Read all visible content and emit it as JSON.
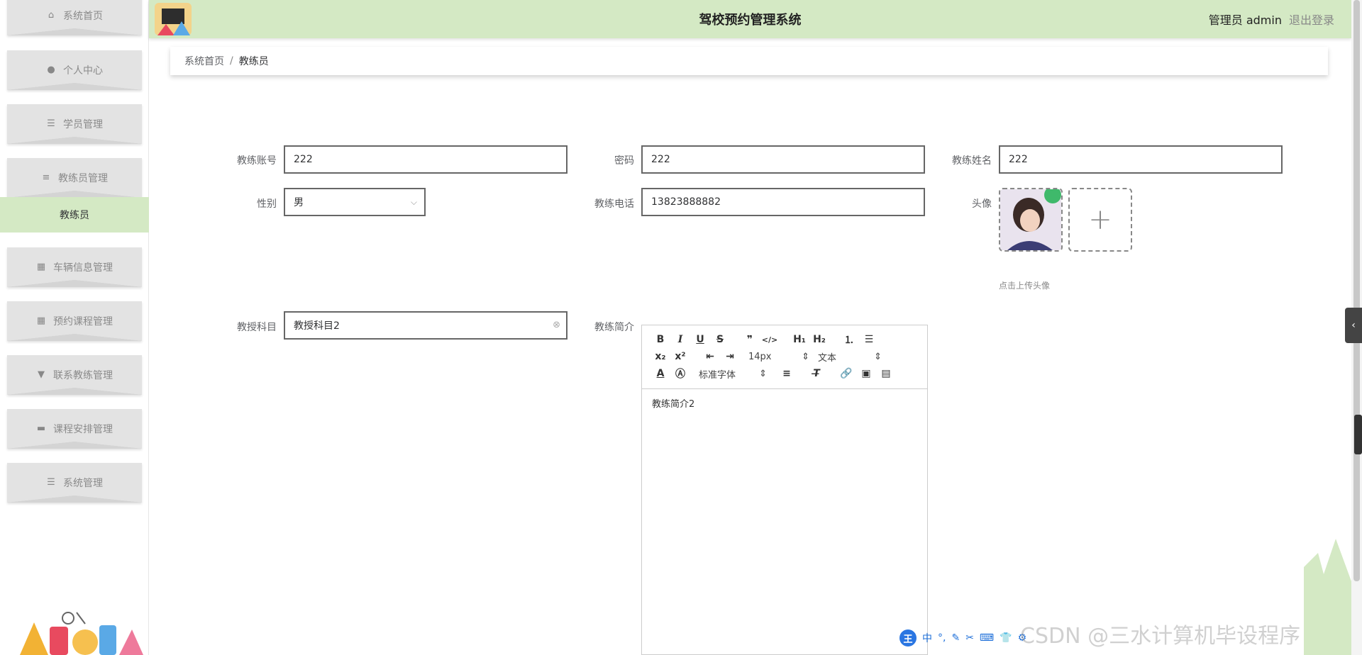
{
  "app": {
    "title": "驾校预约管理系统",
    "user_role": "管理员 admin",
    "logout": "退出登录"
  },
  "sidebar": {
    "items": [
      {
        "label": "系统首页",
        "icon": "home-icon"
      },
      {
        "label": "个人中心",
        "icon": "user-icon"
      },
      {
        "label": "学员管理",
        "icon": "list-icon"
      },
      {
        "label": "教练员管理",
        "icon": "sliders-icon"
      },
      {
        "label": "车辆信息管理",
        "icon": "grid-icon"
      },
      {
        "label": "预约课程管理",
        "icon": "grid-icon"
      },
      {
        "label": "联系教练管理",
        "icon": "brush-icon"
      },
      {
        "label": "课程安排管理",
        "icon": "monitor-icon"
      },
      {
        "label": "系统管理",
        "icon": "menu-icon"
      }
    ],
    "sub_active": "教练员"
  },
  "breadcrumb": {
    "home": "系统首页",
    "separator": "/",
    "current": "教练员"
  },
  "form": {
    "account_label": "教练账号",
    "account_value": "222",
    "password_label": "密码",
    "password_value": "222",
    "name_label": "教练姓名",
    "name_value": "222",
    "gender_label": "性别",
    "gender_value": "男",
    "phone_label": "教练电话",
    "phone_value": "13823888882",
    "avatar_label": "头像",
    "avatar_tip": "点击上传头像",
    "subject_label": "教授科目",
    "subject_value": "教授科目2",
    "intro_label": "教练简介",
    "intro_value": "教练简介2"
  },
  "editor": {
    "font_size": "14px",
    "block_format": "文本",
    "font_family": "标准字体"
  },
  "overlay": {
    "ime_label": "中",
    "ime_logo": "王",
    "watermark": "CSDN @三水计算机毕设程序"
  },
  "colors": {
    "header_bg": "#d4e9c4",
    "sidebar_item_bg": "#e3e3e3",
    "active_sub_bg": "#d4e9c4"
  }
}
